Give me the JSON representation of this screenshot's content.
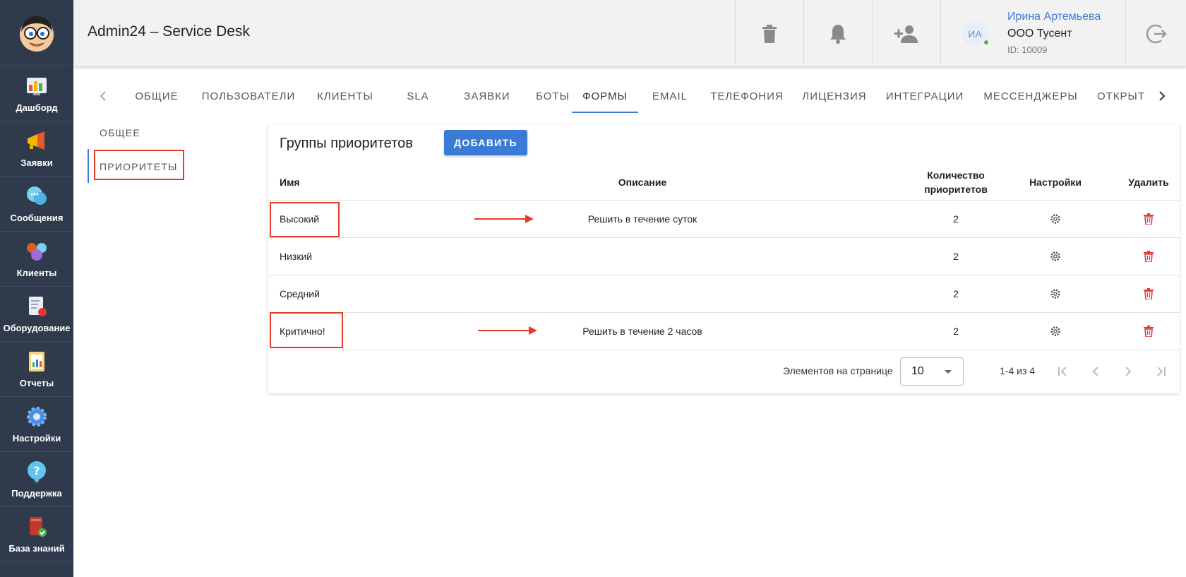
{
  "sidebar": {
    "logo": "avatar-logo",
    "items": [
      {
        "label": "Дашборд",
        "icon": "dashboard-icon"
      },
      {
        "label": "Заявки",
        "icon": "megaphone-icon"
      },
      {
        "label": "Сообщения",
        "icon": "chat-icon"
      },
      {
        "label": "Клиенты",
        "icon": "clients-icon"
      },
      {
        "label": "Оборудование",
        "icon": "equipment-icon"
      },
      {
        "label": "Отчеты",
        "icon": "reports-icon"
      },
      {
        "label": "Настройки",
        "icon": "gear-icon"
      },
      {
        "label": "Поддержка",
        "icon": "help-icon"
      },
      {
        "label": "База знаний",
        "icon": "book-icon"
      }
    ]
  },
  "header": {
    "title": "Admin24 – Service Desk",
    "user": {
      "initials": "ИА",
      "name": "Ирина Артемьева",
      "org": "ООО Тусент",
      "id": "ID: 10009"
    }
  },
  "tabs": [
    {
      "label": "ОБЩИЕ",
      "active": false
    },
    {
      "label": "ПОЛЬЗОВАТЕЛИ",
      "active": false
    },
    {
      "label": "КЛИЕНТЫ",
      "active": false
    },
    {
      "label": "SLA",
      "active": false
    },
    {
      "label": "ЗАЯВКИ",
      "active": false
    },
    {
      "label": "БОТЫ",
      "active": false
    },
    {
      "label": "ФОРМЫ",
      "active": true
    },
    {
      "label": "EMAIL",
      "active": false
    },
    {
      "label": "ТЕЛЕФОНИЯ",
      "active": false
    },
    {
      "label": "ЛИЦЕНЗИЯ",
      "active": false
    },
    {
      "label": "ИНТЕГРАЦИИ",
      "active": false
    },
    {
      "label": "МЕССЕНДЖЕРЫ",
      "active": false
    },
    {
      "label": "ОТКРЫТ",
      "active": false
    }
  ],
  "subnav": {
    "items": [
      {
        "label": "ОБЩЕЕ",
        "active": false
      },
      {
        "label": "ПРИОРИТЕТЫ",
        "active": true
      }
    ]
  },
  "card": {
    "title": "Группы приоритетов",
    "add_label": "ДОБАВИТЬ",
    "columns": {
      "name": "Имя",
      "description": "Описание",
      "count_line1": "Количество",
      "count_line2": "приоритетов",
      "settings": "Настройки",
      "delete": "Удалить"
    },
    "rows": [
      {
        "name": "Высокий",
        "description": "Решить в течение суток",
        "count": "2"
      },
      {
        "name": "Низкий",
        "description": "",
        "count": "2"
      },
      {
        "name": "Средний",
        "description": "",
        "count": "2"
      },
      {
        "name": "Критично!",
        "description": "Решить в течение 2 часов",
        "count": "2"
      }
    ],
    "footer": {
      "per_page_label": "Элементов на странице",
      "per_page_value": "10",
      "range": "1-4 из 4"
    }
  },
  "colors": {
    "sidebar_bg": "#2f3b4c",
    "accent": "#3a7bd5",
    "annotation": "#e53a2a",
    "delete": "#e53935"
  }
}
